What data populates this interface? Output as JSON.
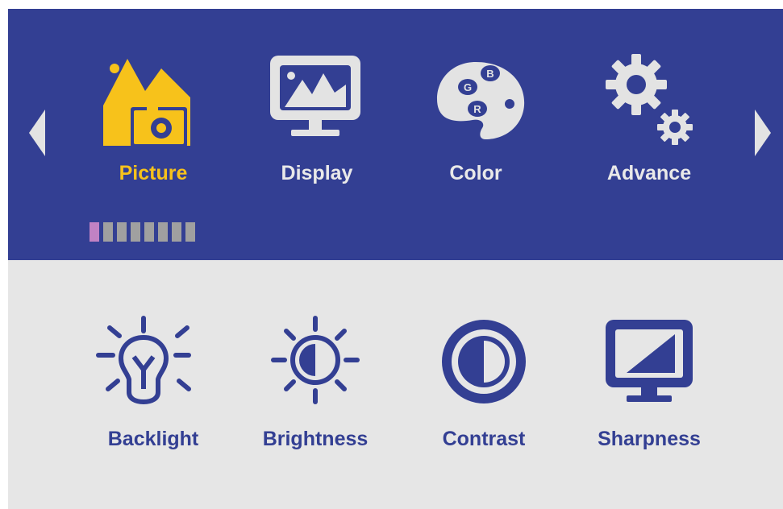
{
  "colors": {
    "band_top": "#333f93",
    "band_bottom": "#e6e6e6",
    "active_accent": "#f7c21b",
    "inactive_text": "#e9e9e9",
    "sub_text": "#333f93",
    "pager_current": "#c182c4",
    "pager_other": "#a0a0a0"
  },
  "nav": {
    "left_arrow_icon": "triangle-left-icon",
    "right_arrow_icon": "triangle-right-icon"
  },
  "categories": [
    {
      "label": "Picture",
      "icon": "picture-icon",
      "active": true
    },
    {
      "label": "Display",
      "icon": "monitor-icon",
      "active": false
    },
    {
      "label": "Color",
      "icon": "palette-icon",
      "active": false
    },
    {
      "label": "Advance",
      "icon": "gears-icon",
      "active": false
    }
  ],
  "pager": {
    "pages": 8,
    "current": 1
  },
  "submenu": [
    {
      "label": "Backlight",
      "icon": "lightbulb-icon"
    },
    {
      "label": "Brightness",
      "icon": "sun-icon"
    },
    {
      "label": "Contrast",
      "icon": "contrast-icon"
    },
    {
      "label": "Sharpness",
      "icon": "sharpness-icon"
    }
  ]
}
